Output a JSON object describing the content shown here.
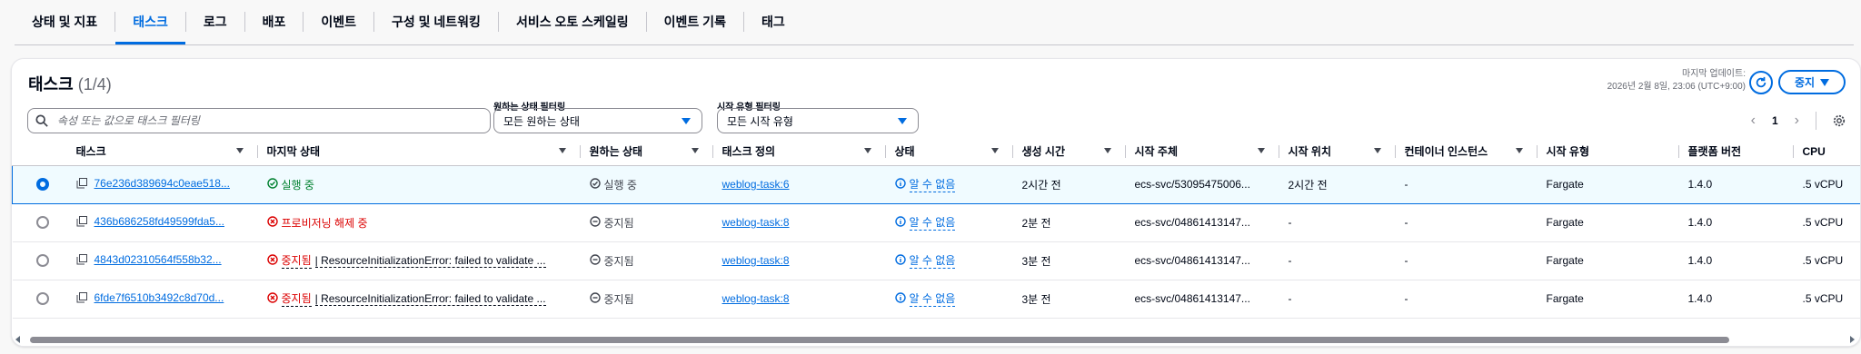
{
  "tabs": [
    {
      "label": "상태 및 지표",
      "active": false
    },
    {
      "label": "태스크",
      "active": true
    },
    {
      "label": "로그",
      "active": false
    },
    {
      "label": "배포",
      "active": false
    },
    {
      "label": "이벤트",
      "active": false
    },
    {
      "label": "구성 및 네트워킹",
      "active": false
    },
    {
      "label": "서비스 오토 스케일링",
      "active": false
    },
    {
      "label": "이벤트 기록",
      "active": false
    },
    {
      "label": "태그",
      "active": false
    }
  ],
  "header": {
    "title": "태스크",
    "count": "(1/4)",
    "updated_label": "마지막 업데이트:",
    "updated_value": "2026년 2월 8일, 23:06 (UTC+9:00)",
    "stop_label": "중지"
  },
  "search": {
    "placeholder": "속성 또는 값으로 태스크 필터링"
  },
  "filters": {
    "desired": {
      "label": "원하는 상태 필터링",
      "value": "모든 원하는 상태"
    },
    "launch": {
      "label": "시작 유형 필터링",
      "value": "모든 시작 유형"
    }
  },
  "pager": {
    "page": "1"
  },
  "columns": [
    "태스크",
    "마지막 상태",
    "원하는 상태",
    "태스크 정의",
    "상태",
    "생성 시간",
    "시작 주체",
    "시작 위치",
    "컨테이너 인스턴스",
    "시작 유형",
    "플랫폼 버전",
    "CPU"
  ],
  "rows": [
    {
      "selected": true,
      "task": "76e236d389694c0eae518...",
      "last_status": "실행 중",
      "last_kind": "ok",
      "last_detail": "",
      "desired": "실행 중",
      "desired_kind": "ok",
      "taskdef": "weblog-task:6",
      "health": "알 수 없음",
      "created": "2시간 전",
      "started_by": "ecs-svc/53095475006...",
      "started_at": "2시간 전",
      "container_instance": "-",
      "launch_type": "Fargate",
      "platform": "1.4.0",
      "cpu": ".5 vCPU"
    },
    {
      "selected": false,
      "task": "436b686258fd49599fda5...",
      "last_status": "프로비저닝 해제 중",
      "last_kind": "err",
      "last_detail": "",
      "desired": "중지됨",
      "desired_kind": "stop",
      "taskdef": "weblog-task:8",
      "health": "알 수 없음",
      "created": "2분 전",
      "started_by": "ecs-svc/04861413147...",
      "started_at": "-",
      "container_instance": "-",
      "launch_type": "Fargate",
      "platform": "1.4.0",
      "cpu": ".5 vCPU"
    },
    {
      "selected": false,
      "task": "4843d02310564f558b32...",
      "last_status": "중지됨",
      "last_kind": "err",
      "last_detail": "| ResourceInitializationError: failed to validate ...",
      "desired": "중지됨",
      "desired_kind": "stop",
      "taskdef": "weblog-task:8",
      "health": "알 수 없음",
      "created": "3분 전",
      "started_by": "ecs-svc/04861413147...",
      "started_at": "-",
      "container_instance": "-",
      "launch_type": "Fargate",
      "platform": "1.4.0",
      "cpu": ".5 vCPU"
    },
    {
      "selected": false,
      "task": "6fde7f6510b3492c8d70d...",
      "last_status": "중지됨",
      "last_kind": "err",
      "last_detail": "| ResourceInitializationError: failed to validate ...",
      "desired": "중지됨",
      "desired_kind": "stop",
      "taskdef": "weblog-task:8",
      "health": "알 수 없음",
      "created": "3분 전",
      "started_by": "ecs-svc/04861413147...",
      "started_at": "-",
      "container_instance": "-",
      "launch_type": "Fargate",
      "platform": "1.4.0",
      "cpu": ".5 vCPU"
    }
  ],
  "colors": {
    "accent": "#006ce0",
    "success": "#00802f",
    "error": "#db0000"
  }
}
